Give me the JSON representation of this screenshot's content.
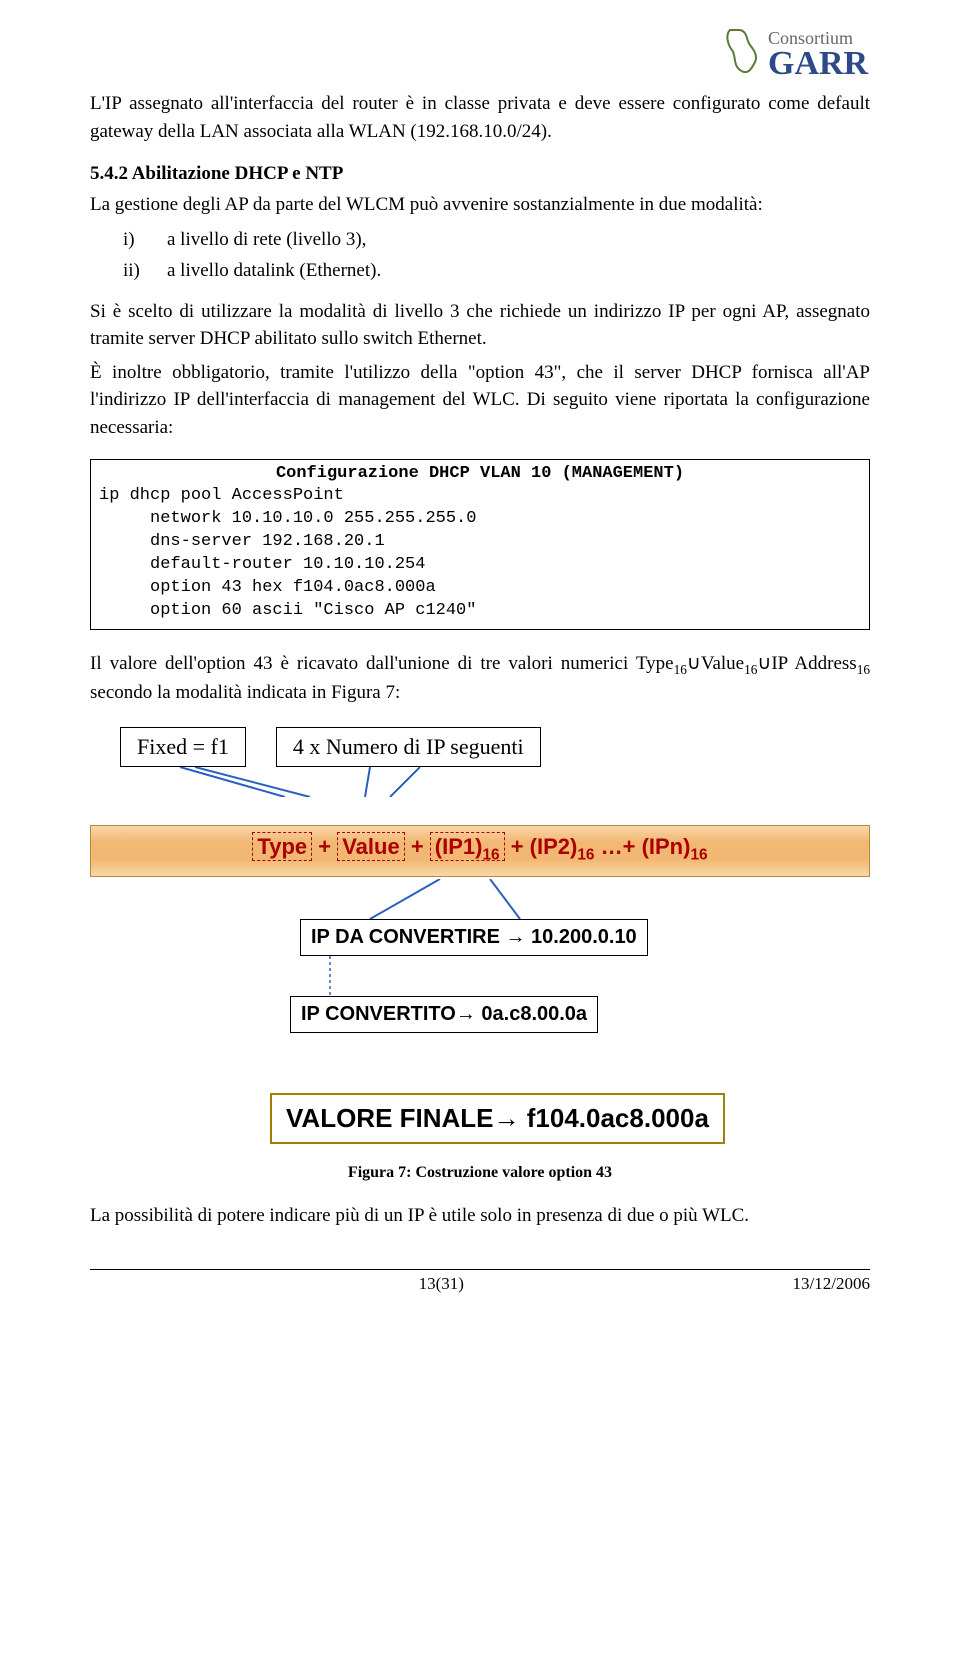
{
  "logo": {
    "line1": "Consortium",
    "line2": "GARR"
  },
  "p1": "L'IP assegnato all'interfaccia del router è in classe privata e deve essere configurato come default gateway della LAN associata alla WLAN (192.168.10.0/24).",
  "h2": "5.4.2 Abilitazione DHCP e NTP",
  "p2a": "La gestione degli AP da parte del WLCM può avvenire sostanzialmente in due modalità:",
  "list": {
    "i": "a livello di rete (livello 3),",
    "ii": "a livello datalink (Ethernet)."
  },
  "p2b": "Si è scelto di utilizzare la modalità di livello 3 che  richiede un indirizzo IP per ogni AP, assegnato tramite server DHCP abilitato sullo switch Ethernet.",
  "p2c": "È inoltre obbligatorio, tramite l'utilizzo della \"option 43\", che il server DHCP fornisca all'AP l'indirizzo IP dell'interfaccia di management del WLC. Di seguito viene riportata la configurazione necessaria:",
  "code": {
    "title": "Configurazione DHCP VLAN 10 (MANAGEMENT)",
    "body": "ip dhcp pool AccessPoint\n     network 10.10.10.0 255.255.255.0\n     dns-server 192.168.20.1\n     default-router 10.10.10.254\n     option 43 hex f104.0ac8.000a\n     option 60 ascii \"Cisco AP c1240\""
  },
  "p3a": "Il valore dell'option 43 è ricavato dall'unione di tre valori numerici Type",
  "p3b": "Value",
  "p3c": "IP Address",
  "p3d": " secondo la modalità indicata in Figura 7:",
  "sub16": "16",
  "diagram": {
    "fixed": "Fixed = f1",
    "count": "4 x Numero di IP seguenti",
    "type": "Type",
    "value": "Value",
    "ip1": "(IP1)",
    "ip2": "(IP2)",
    "ipn": "(IPn)",
    "plus": " + ",
    "ell": " …+ ",
    "ip_da_conv": "IP DA CONVERTIRE → 10.200.0.10",
    "ip_conv": "IP CONVERTITO→ 0a.c8.00.0a",
    "final": "VALORE FINALE→ f104.0ac8.000a"
  },
  "caption": "Figura 7: Costruzione valore option 43",
  "p4": "La possibilità di potere indicare più di un IP è utile solo in presenza di due o più WLC.",
  "footer": {
    "page": "13(31)",
    "date": "13/12/2006"
  }
}
